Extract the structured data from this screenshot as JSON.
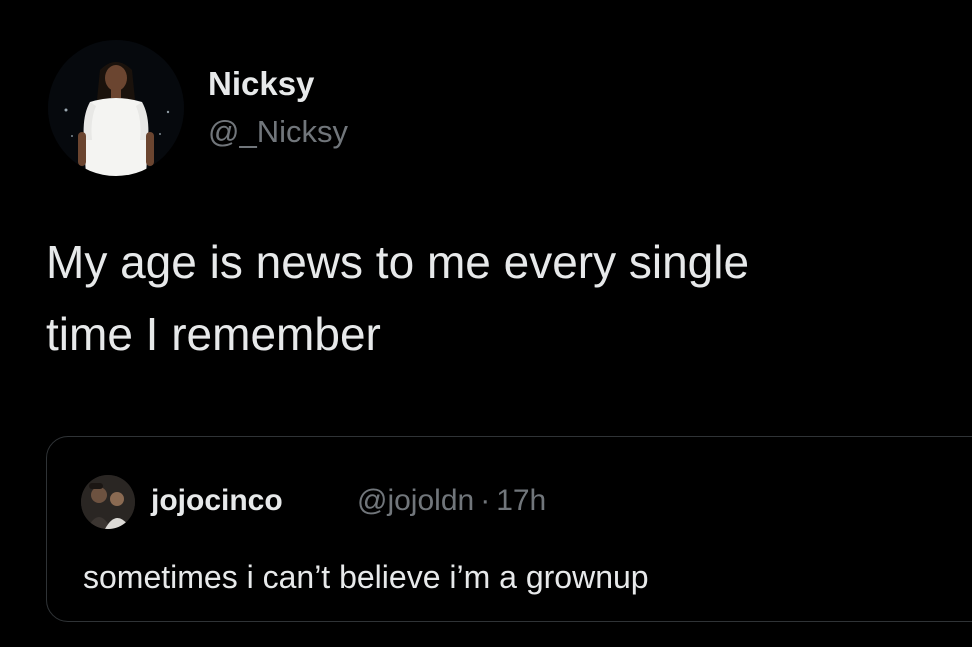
{
  "tweet": {
    "author": {
      "display_name": "Nicksy",
      "handle": "@_Nicksy",
      "avatar": "profile-photo"
    },
    "text_lines": [
      "My age is news to me every single",
      "time I remember"
    ],
    "quoted_tweet": {
      "display_name": "jojocinco",
      "handle": "@jojoldn",
      "separator": "·",
      "time": "17h",
      "avatar": "profile-photo",
      "text": "sometimes i can’t believe i’m a grownup"
    }
  },
  "colors": {
    "background": "#000000",
    "primary_text": "#e7e9ea",
    "secondary_text": "#71767b",
    "border": "#2f3336"
  }
}
